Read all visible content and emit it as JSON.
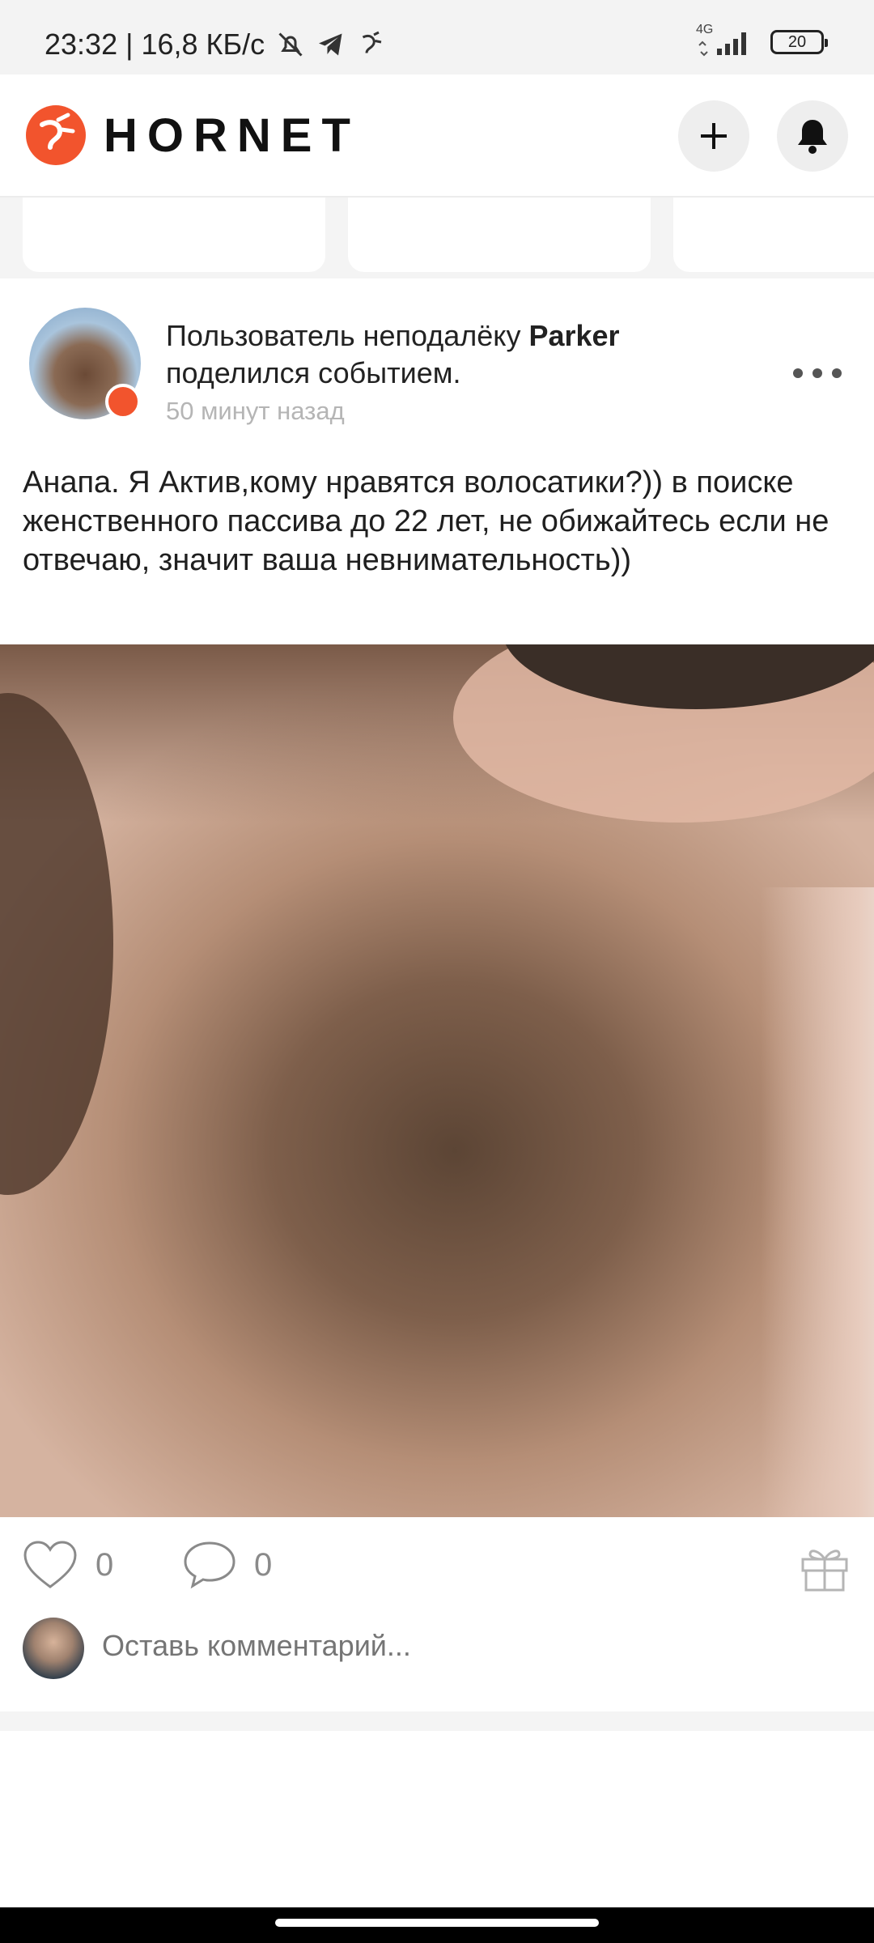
{
  "status_bar": {
    "time_speed": "23:32 | 16,8 КБ/с",
    "network": "4G",
    "battery": "20",
    "icons": [
      "mute-icon",
      "telegram-icon",
      "hornet-notify-icon"
    ]
  },
  "header": {
    "brand": "HORNET",
    "add_icon": "plus-icon",
    "bell_icon": "bell-icon"
  },
  "colors": {
    "accent": "#f2542d",
    "muted": "#b5b5b5",
    "text": "#222222"
  },
  "post": {
    "head_prefix": "Пользователь неподалёку ",
    "author": "Parker",
    "head_suffix": "поделился событием.",
    "time": "50 минут назад",
    "text": "Анапа. Я Актив,кому нравятся волосатики?)) в поиске женственного пассива до 22 лет, не обижайтесь если не отвечаю, значит ваша невнимательность))",
    "likes": "0",
    "comments": "0",
    "comment_placeholder": "Оставь комментарий..."
  }
}
